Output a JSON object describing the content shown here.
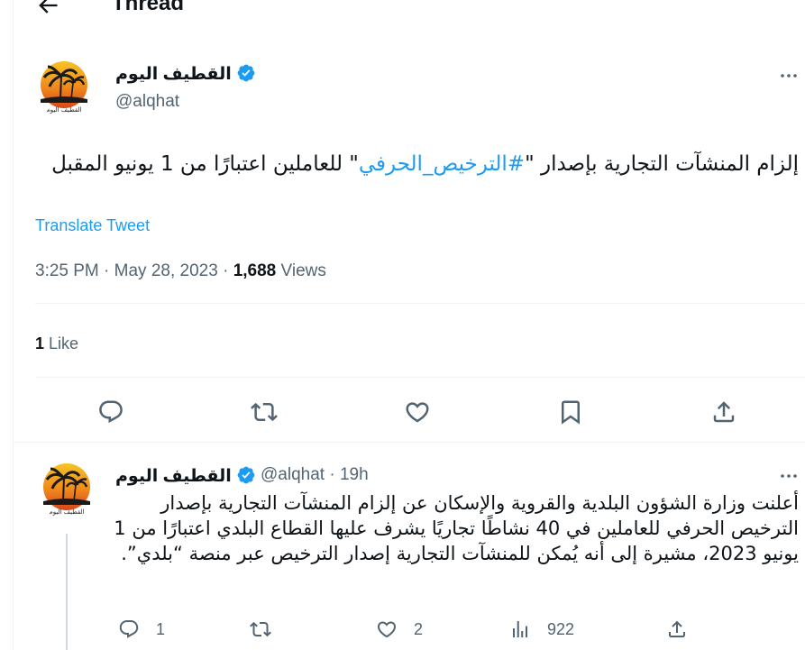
{
  "header": {
    "title": "Thread"
  },
  "main_tweet": {
    "author_name": "القطيف اليوم",
    "handle": "@alqhat",
    "text_before": "إلزام المنشآت التجارية بإصدار \"",
    "hashtag": "#الترخيص_الحرفي",
    "text_after": "\" للعاملين اعتبارًا من 1 يونيو المقبل",
    "translate_label": "Translate Tweet",
    "time": "3:25 PM",
    "date": "May 28, 2023",
    "views_count": "1,688",
    "views_label": "Views",
    "likes_count": "1",
    "likes_label": "Like"
  },
  "reply": {
    "author_name": "القطيف اليوم",
    "handle": "@alqhat",
    "time_ago": "19h",
    "text": "أعلنت وزارة الشؤون البلدية والقروية والإسكان عن إلزام المنشآت التجارية بإصدار الترخيص الحرفي للعاملين في 40 نشاطًا تجاريًا يشرف عليها القطاع البلدي اعتبارًا من 1 يونيو 2023، مشيرة إلى أنه يُمكن للمنشآت التجارية إصدار الترخيص عبر منصة “بلدي”.",
    "reply_count": "1",
    "like_count": "2",
    "view_count": "922"
  },
  "avatar_caption": "القطيف اليوم",
  "colors": {
    "accent": "#1d9bf0",
    "secondary_text": "#536471",
    "divider": "#eff3f4"
  }
}
